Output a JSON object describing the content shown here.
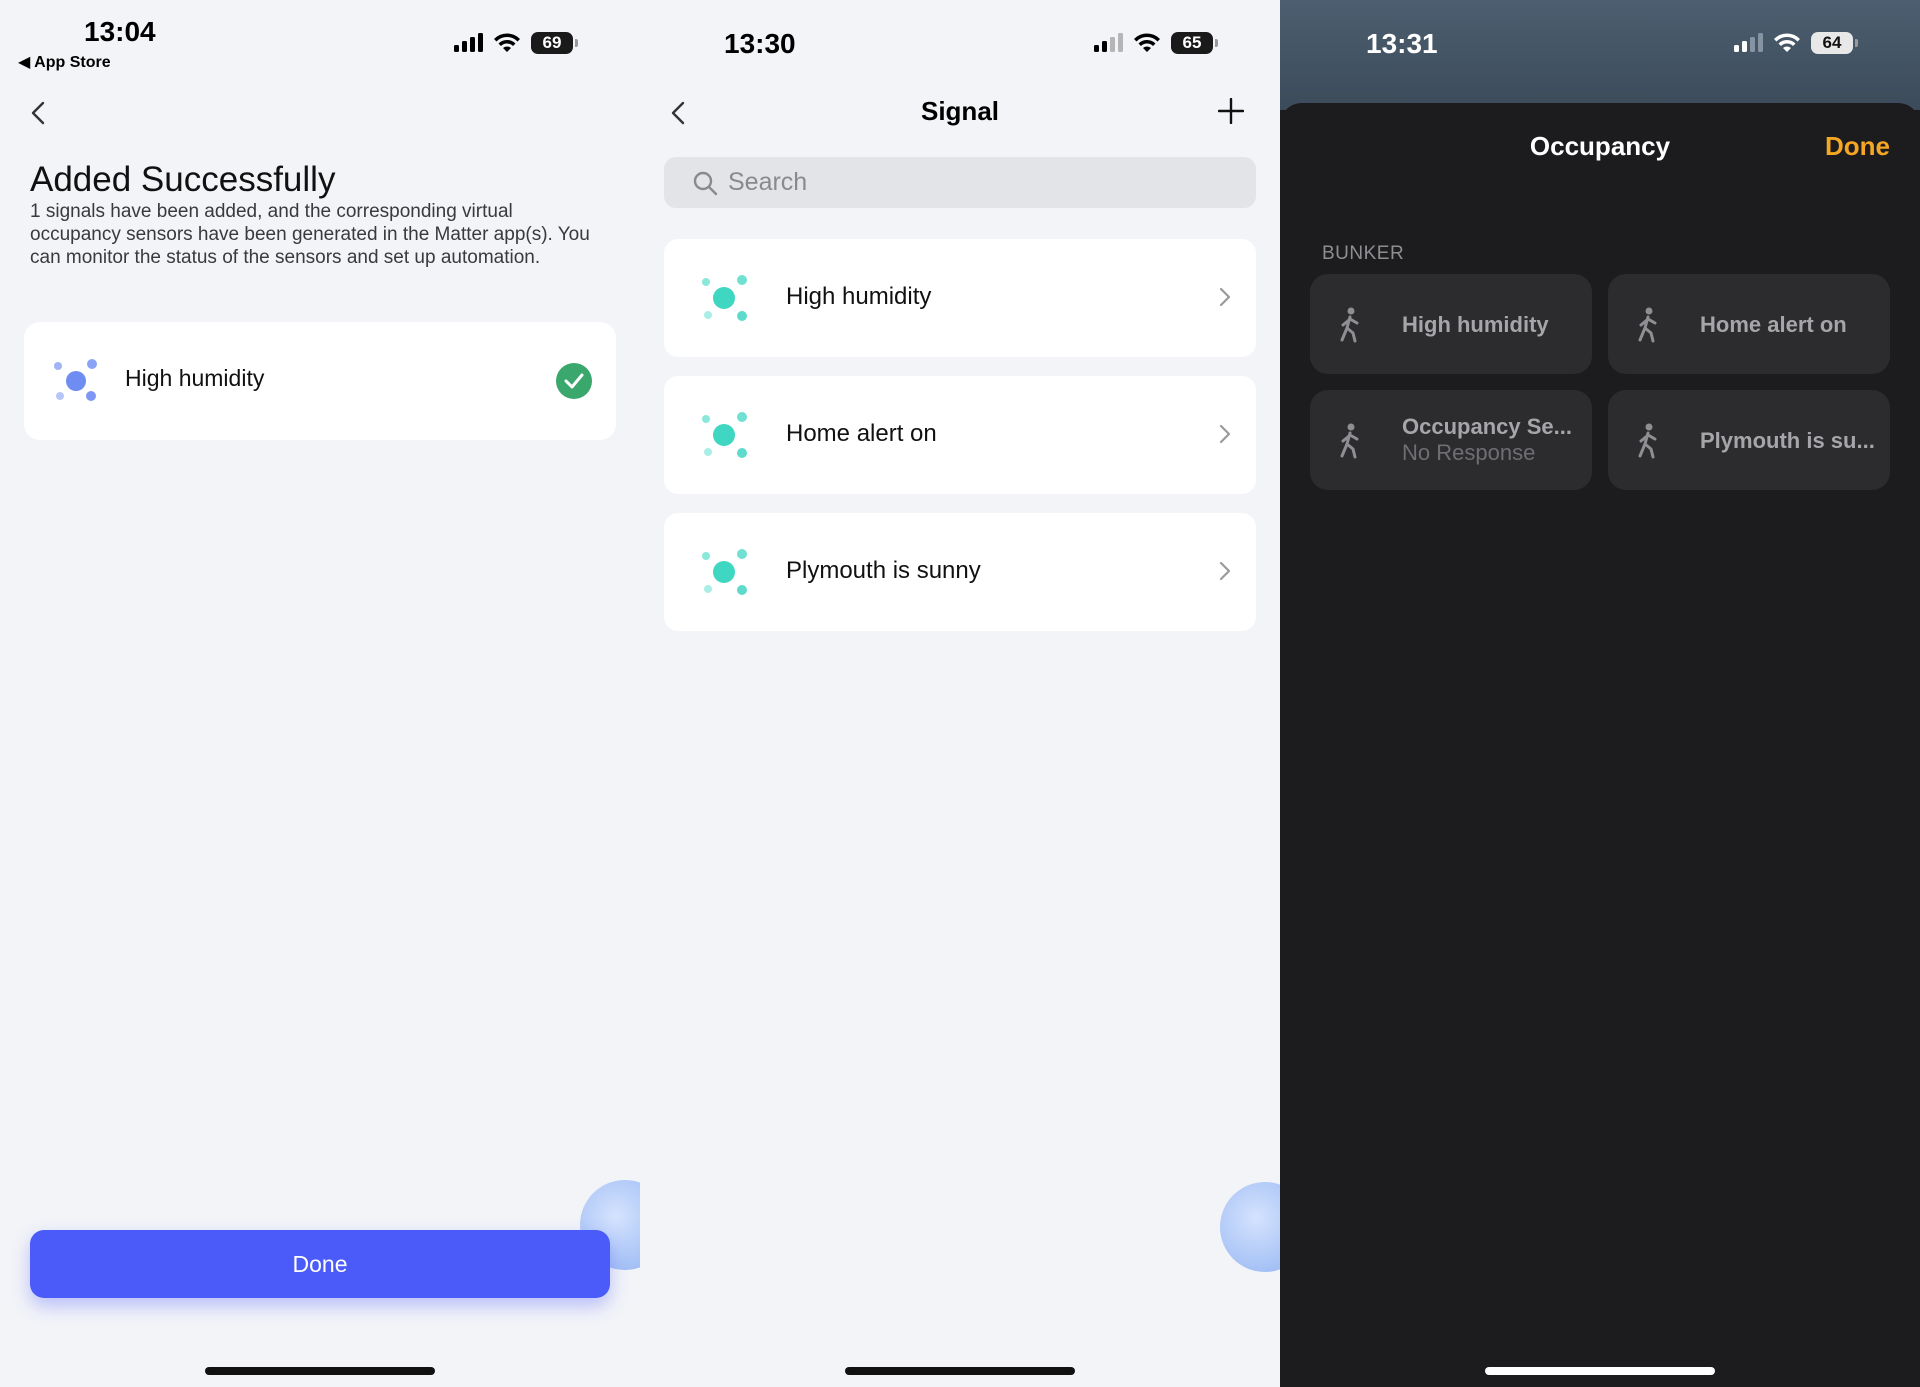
{
  "panel1": {
    "status": {
      "time": "13:04",
      "battery": "69",
      "back_app": "◀ App Store"
    },
    "title": "Added Successfully",
    "description": "1 signals have been added, and the corresponding virtual occupancy sensors have been generated in the Matter app(s). You can monitor the status of the sensors and set up automation.",
    "item": {
      "label": "High humidity",
      "icon": "signal-dots-icon",
      "status_icon": "check-circle-icon"
    },
    "done_label": "Done",
    "colors": {
      "accent": "#4a5bfa",
      "check": "#3aa76d"
    }
  },
  "panel2": {
    "status": {
      "time": "13:30",
      "battery": "65"
    },
    "nav_title": "Signal",
    "search_placeholder": "Search",
    "items": [
      {
        "label": "High humidity"
      },
      {
        "label": "Home alert on"
      },
      {
        "label": "Plymouth is sunny"
      }
    ],
    "colors": {
      "icon": "#3fd6c2"
    }
  },
  "panel3": {
    "status": {
      "time": "13:31",
      "battery": "64"
    },
    "sheet_title": "Occupancy",
    "done_label": "Done",
    "section": "BUNKER",
    "tiles": [
      {
        "name": "High humidity",
        "sub": ""
      },
      {
        "name": "Home alert on",
        "sub": ""
      },
      {
        "name": "Occupancy Se...",
        "sub": "No Response"
      },
      {
        "name": "Plymouth is su...",
        "sub": ""
      }
    ],
    "colors": {
      "done": "#f5a623",
      "sheet": "#1c1c1e",
      "tile": "#2c2c2e"
    }
  }
}
